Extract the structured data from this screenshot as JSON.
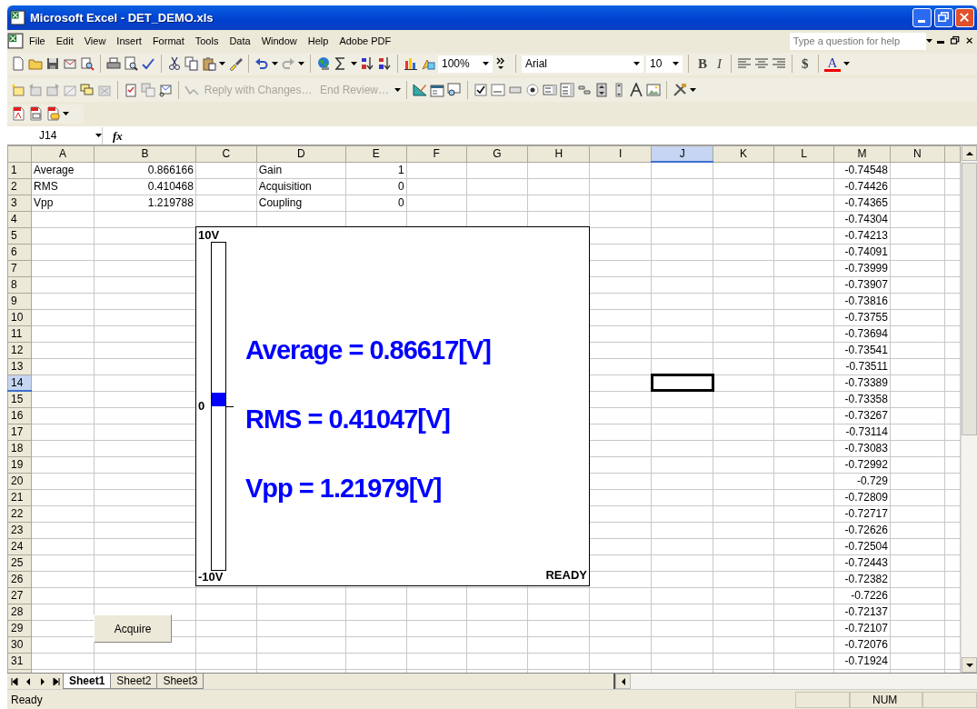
{
  "window": {
    "title": "Microsoft Excel - DET_DEMO.xls"
  },
  "menu": [
    "File",
    "Edit",
    "View",
    "Insert",
    "Format",
    "Tools",
    "Data",
    "Window",
    "Help",
    "Adobe PDF"
  ],
  "help_box": {
    "placeholder": "Type a question for help"
  },
  "toolbar": {
    "zoom": "100%",
    "font": "Arial",
    "size": "10",
    "bold": "B",
    "italic": "I",
    "currency": "$",
    "font_color": "A"
  },
  "review": [
    {
      "label": "Reply with Changes…",
      "disabled": true
    },
    {
      "label": "End Review…",
      "disabled": true
    }
  ],
  "formula_bar": {
    "name_box": "J14",
    "function_label": "fx"
  },
  "columns": [
    {
      "label": "A",
      "selected": false
    },
    {
      "label": "B",
      "selected": false
    },
    {
      "label": "C",
      "selected": false
    },
    {
      "label": "D",
      "selected": false
    },
    {
      "label": "E",
      "selected": false
    },
    {
      "label": "F",
      "selected": false
    },
    {
      "label": "G",
      "selected": false
    },
    {
      "label": "H",
      "selected": false
    },
    {
      "label": "I",
      "selected": false
    },
    {
      "label": "J",
      "selected": true
    },
    {
      "label": "K",
      "selected": false
    },
    {
      "label": "L",
      "selected": false
    },
    {
      "label": "M",
      "selected": false
    },
    {
      "label": "N",
      "selected": false
    }
  ],
  "rows": [
    {
      "label": "1",
      "selected": false,
      "cells": {
        "A": {
          "text": "Average",
          "kind": "text"
        },
        "B": {
          "text": "0.866166",
          "kind": "number"
        },
        "D": {
          "text": "Gain",
          "kind": "text"
        },
        "E": {
          "text": "1",
          "kind": "number"
        },
        "M": {
          "text": "-0.74548",
          "kind": "number"
        }
      }
    },
    {
      "label": "2",
      "selected": false,
      "cells": {
        "A": {
          "text": "RMS",
          "kind": "text"
        },
        "B": {
          "text": "0.410468",
          "kind": "number"
        },
        "D": {
          "text": "Acquisition",
          "kind": "text"
        },
        "E": {
          "text": "0",
          "kind": "number"
        },
        "M": {
          "text": "-0.74426",
          "kind": "number"
        }
      }
    },
    {
      "label": "3",
      "selected": false,
      "cells": {
        "A": {
          "text": "Vpp",
          "kind": "text"
        },
        "B": {
          "text": "1.219788",
          "kind": "number"
        },
        "D": {
          "text": "Coupling",
          "kind": "text"
        },
        "E": {
          "text": "0",
          "kind": "number"
        },
        "M": {
          "text": "-0.74365",
          "kind": "number"
        }
      }
    },
    {
      "label": "4",
      "selected": false,
      "cells": {
        "M": {
          "text": "-0.74304",
          "kind": "number"
        }
      }
    },
    {
      "label": "5",
      "selected": false,
      "cells": {
        "M": {
          "text": "-0.74213",
          "kind": "number"
        }
      }
    },
    {
      "label": "6",
      "selected": false,
      "cells": {
        "M": {
          "text": "-0.74091",
          "kind": "number"
        }
      }
    },
    {
      "label": "7",
      "selected": false,
      "cells": {
        "M": {
          "text": "-0.73999",
          "kind": "number"
        }
      }
    },
    {
      "label": "8",
      "selected": false,
      "cells": {
        "M": {
          "text": "-0.73907",
          "kind": "number"
        }
      }
    },
    {
      "label": "9",
      "selected": false,
      "cells": {
        "M": {
          "text": "-0.73816",
          "kind": "number"
        }
      }
    },
    {
      "label": "10",
      "selected": false,
      "cells": {
        "M": {
          "text": "-0.73755",
          "kind": "number"
        }
      }
    },
    {
      "label": "11",
      "selected": false,
      "cells": {
        "M": {
          "text": "-0.73694",
          "kind": "number"
        }
      }
    },
    {
      "label": "12",
      "selected": false,
      "cells": {
        "M": {
          "text": "-0.73541",
          "kind": "number"
        }
      }
    },
    {
      "label": "13",
      "selected": false,
      "cells": {
        "M": {
          "text": "-0.73511",
          "kind": "number"
        }
      }
    },
    {
      "label": "14",
      "selected": true,
      "cells": {
        "M": {
          "text": "-0.73389",
          "kind": "number"
        }
      }
    },
    {
      "label": "15",
      "selected": false,
      "cells": {
        "M": {
          "text": "-0.73358",
          "kind": "number"
        }
      }
    },
    {
      "label": "16",
      "selected": false,
      "cells": {
        "M": {
          "text": "-0.73267",
          "kind": "number"
        }
      }
    },
    {
      "label": "17",
      "selected": false,
      "cells": {
        "M": {
          "text": "-0.73114",
          "kind": "number"
        }
      }
    },
    {
      "label": "18",
      "selected": false,
      "cells": {
        "M": {
          "text": "-0.73083",
          "kind": "number"
        }
      }
    },
    {
      "label": "19",
      "selected": false,
      "cells": {
        "M": {
          "text": "-0.72992",
          "kind": "number"
        }
      }
    },
    {
      "label": "20",
      "selected": false,
      "cells": {
        "M": {
          "text": "-0.729",
          "kind": "number"
        }
      }
    },
    {
      "label": "21",
      "selected": false,
      "cells": {
        "M": {
          "text": "-0.72809",
          "kind": "number"
        }
      }
    },
    {
      "label": "22",
      "selected": false,
      "cells": {
        "M": {
          "text": "-0.72717",
          "kind": "number"
        }
      }
    },
    {
      "label": "23",
      "selected": false,
      "cells": {
        "M": {
          "text": "-0.72626",
          "kind": "number"
        }
      }
    },
    {
      "label": "24",
      "selected": false,
      "cells": {
        "M": {
          "text": "-0.72504",
          "kind": "number"
        }
      }
    },
    {
      "label": "25",
      "selected": false,
      "cells": {
        "M": {
          "text": "-0.72443",
          "kind": "number"
        }
      }
    },
    {
      "label": "26",
      "selected": false,
      "cells": {
        "M": {
          "text": "-0.72382",
          "kind": "number"
        }
      }
    },
    {
      "label": "27",
      "selected": false,
      "cells": {
        "M": {
          "text": "-0.7226",
          "kind": "number"
        }
      }
    },
    {
      "label": "28",
      "selected": false,
      "cells": {
        "M": {
          "text": "-0.72137",
          "kind": "number"
        }
      }
    },
    {
      "label": "29",
      "selected": false,
      "cells": {
        "M": {
          "text": "-0.72107",
          "kind": "number"
        }
      }
    },
    {
      "label": "30",
      "selected": false,
      "cells": {
        "M": {
          "text": "-0.72076",
          "kind": "number"
        }
      }
    },
    {
      "label": "31",
      "selected": false,
      "cells": {
        "M": {
          "text": "-0.71924",
          "kind": "number"
        }
      }
    }
  ],
  "meter": {
    "top_label": "10V",
    "zero_label": "0",
    "bottom_label": "-10V",
    "level": 0.543,
    "lines": [
      "Average = 0.86617[V]",
      "RMS = 0.41047[V]",
      "Vpp = 1.21979[V]"
    ],
    "status": "READY"
  },
  "acquire_button": {
    "label": "Acquire"
  },
  "sheet_tabs": [
    {
      "label": "Sheet1",
      "selected": true
    },
    {
      "label": "Sheet2",
      "selected": false
    },
    {
      "label": "Sheet3",
      "selected": false
    }
  ],
  "status_bar": {
    "message": "Ready",
    "num_lock": "NUM"
  }
}
